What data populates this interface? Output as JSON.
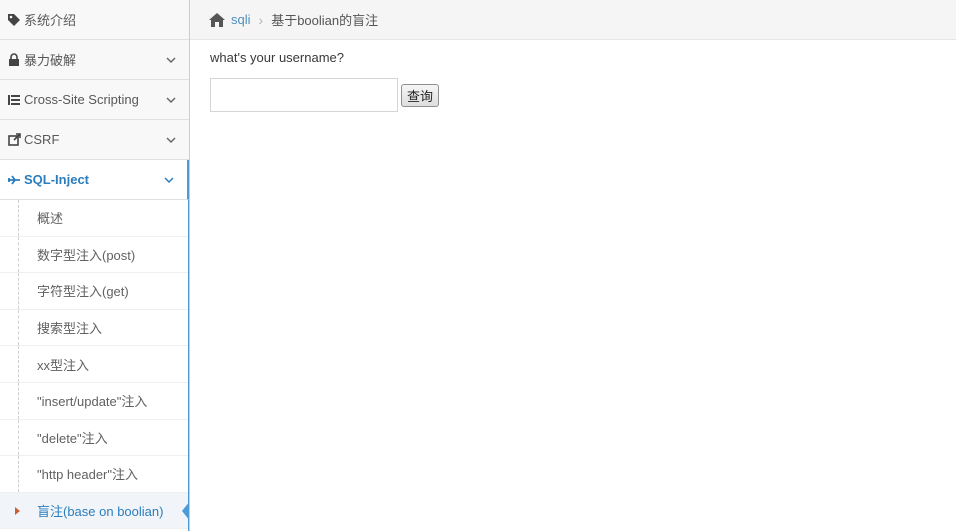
{
  "sidebar": {
    "items": [
      {
        "label": "系统介绍",
        "icon": "tags-icon"
      },
      {
        "label": "暴力破解",
        "icon": "lock-icon"
      },
      {
        "label": "Cross-Site Scripting",
        "icon": "sitemap-icon"
      },
      {
        "label": "CSRF",
        "icon": "share-icon"
      },
      {
        "label": "SQL-Inject",
        "icon": "plane-icon"
      }
    ],
    "submenu": [
      {
        "label": "概述"
      },
      {
        "label": "数字型注入(post)"
      },
      {
        "label": "字符型注入(get)"
      },
      {
        "label": "搜索型注入"
      },
      {
        "label": "xx型注入"
      },
      {
        "label": "\"insert/update\"注入"
      },
      {
        "label": "\"delete\"注入"
      },
      {
        "label": "\"http header\"注入"
      },
      {
        "label": "盲注(base on boolian)"
      }
    ]
  },
  "breadcrumb": {
    "link": "sqli",
    "separator": "›",
    "current": "基于boolian的盲注"
  },
  "main": {
    "question": "what's your username?",
    "input_value": "",
    "submit_label": "查询"
  },
  "colors": {
    "accent": "#2b7dbc",
    "active_border": "#4d9ad8",
    "caret": "#c86139"
  }
}
